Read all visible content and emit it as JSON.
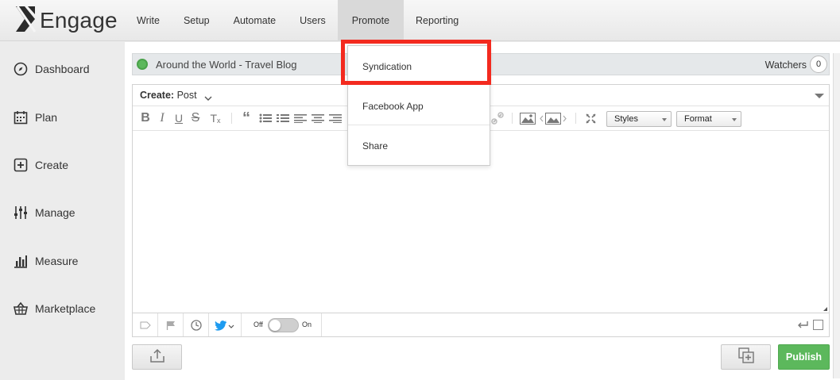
{
  "app": {
    "logo_text": "Engage",
    "logo_icon": "engage-logo-icon"
  },
  "nav": {
    "items": [
      {
        "label": "Write"
      },
      {
        "label": "Setup"
      },
      {
        "label": "Automate"
      },
      {
        "label": "Users"
      },
      {
        "label": "Promote",
        "active": true
      },
      {
        "label": "Reporting"
      }
    ]
  },
  "sidebar": {
    "items": [
      {
        "label": "Dashboard",
        "icon": "compass-icon"
      },
      {
        "label": "Plan",
        "icon": "calendar-icon"
      },
      {
        "label": "Create",
        "icon": "plus-square-icon"
      },
      {
        "label": "Manage",
        "icon": "sliders-icon"
      },
      {
        "label": "Measure",
        "icon": "bar-chart-icon"
      },
      {
        "label": "Marketplace",
        "icon": "basket-icon"
      }
    ]
  },
  "blog": {
    "title": "Around the World - Travel Blog",
    "status_color": "#5cb85c",
    "watchers_label": "Watchers",
    "watchers_count": "0"
  },
  "editor": {
    "create_label": "Create:",
    "create_value": "Post",
    "styles_select": "Styles",
    "format_select": "Format",
    "toolbar_icons": [
      "bold-icon",
      "italic-icon",
      "underline-icon",
      "strikethrough-icon",
      "clear-format-icon",
      "blockquote-icon",
      "bulleted-list-icon",
      "numbered-list-icon",
      "align-left-icon",
      "align-center-icon",
      "align-right-icon",
      "unlink-icon",
      "image-icon",
      "image-gallery-icon",
      "maximize-icon"
    ]
  },
  "bottombar": {
    "toggle_off_label": "Off",
    "toggle_on_label": "On",
    "toggle_state": "off"
  },
  "buttons": {
    "publish": "Publish",
    "publish_color": "#5cb85c"
  },
  "promote_menu": {
    "items": [
      {
        "label": "Syndication"
      },
      {
        "label": "Facebook App"
      },
      {
        "label": "Share"
      }
    ],
    "highlight_color": "#f32a1f"
  }
}
